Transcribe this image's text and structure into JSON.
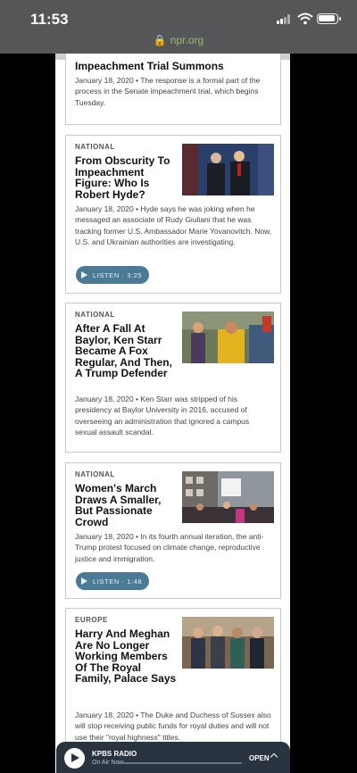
{
  "status_bar": {
    "time": "11:53"
  },
  "browser": {
    "url": "npr.org"
  },
  "stories": [
    {
      "section": "",
      "title": "Impeachment Trial Summons",
      "teaser": "January 18, 2020 • The response is a formal part of the process in the Senate impeachment trial, which begins Tuesday."
    },
    {
      "section": "NATIONAL",
      "title": "From Obscurity To Impeachment Figure: Who Is Robert Hyde?",
      "teaser": "January 18, 2020 • Hyde says he was joking when he messaged an associate of Rudy Giuliani that he was tracking former U.S. Ambassador Marie Yovanovitch. Now, U.S. and Ukrainian authorities are investigating.",
      "listen": "LISTEN · 3:25"
    },
    {
      "section": "NATIONAL",
      "title": "After A Fall At Baylor, Ken Starr Became A Fox Regular, And Then, A Trump Defender",
      "teaser": "January 18, 2020 • Ken Starr was stripped of his presidency at Baylor University in 2016, accused of overseeing an administration that ignored a campus sexual assault scandal."
    },
    {
      "section": "NATIONAL",
      "title": "Women's March Draws A Smaller, But Passionate Crowd",
      "teaser": "January 18, 2020 • In its fourth annual iteration, the anti-Trump protest focused on climate change, reproductive justice and immigration.",
      "listen": "LISTEN · 1:48"
    },
    {
      "section": "EUROPE",
      "title": "Harry And Meghan Are No Longer Working Members Of The Royal Family, Palace Says",
      "teaser": "January 18, 2020 • The Duke and Duchess of Sussex also will stop receiving public funds for royal duties and will not use their \"royal highness\" titles."
    }
  ],
  "player": {
    "station": "KPBS RADIO",
    "status": "On Air Now",
    "open_label": "OPEN"
  }
}
